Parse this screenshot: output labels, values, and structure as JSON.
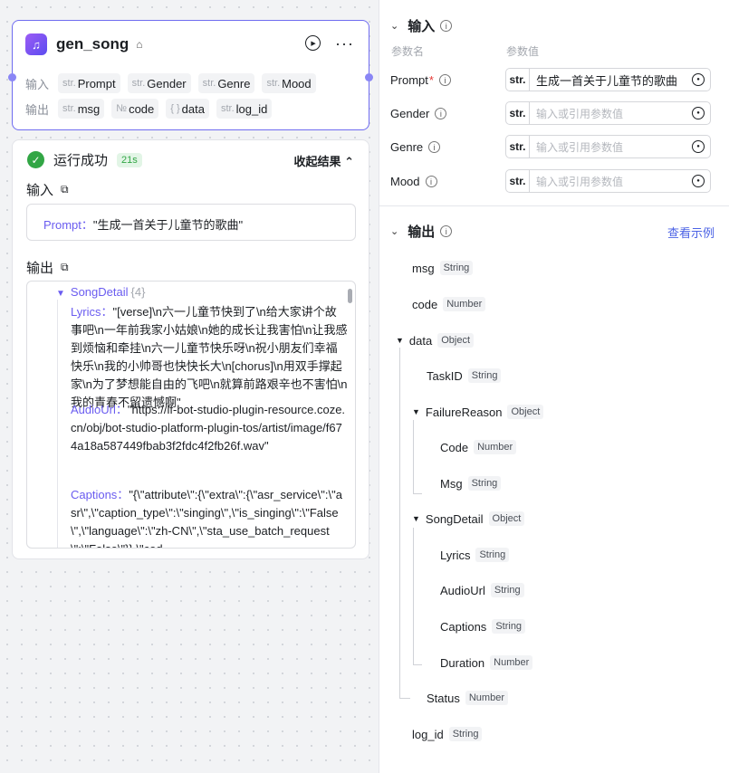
{
  "node": {
    "title": "gen_song",
    "input_label": "输入",
    "output_label": "输出",
    "inputs": [
      {
        "type": "str.",
        "name": "Prompt"
      },
      {
        "type": "str.",
        "name": "Gender"
      },
      {
        "type": "str.",
        "name": "Genre"
      },
      {
        "type": "str.",
        "name": "Mood"
      }
    ],
    "outputs": [
      {
        "type": "str.",
        "name": "msg"
      },
      {
        "type": "№",
        "name": "code"
      },
      {
        "type": "{ }",
        "name": "data"
      },
      {
        "type": "str.",
        "name": "log_id"
      }
    ]
  },
  "result": {
    "status": "运行成功",
    "time": "21s",
    "collapse_label": "收起结果 ⌃",
    "input_title": "输入",
    "input_key": "Prompt：",
    "input_value": "\"生成一首关于儿童节的歌曲\"",
    "output_title": "输出",
    "song_detail_key": "SongDetail",
    "song_detail_count": "{4}",
    "lyrics_key": "Lyrics：",
    "lyrics_value": "\"[verse]\\n六一儿童节快到了\\n给大家讲个故事吧\\n一年前我家小姑娘\\n她的成长让我害怕\\n让我感到烦恼和牵挂\\n六一儿童节快乐呀\\n祝小朋友们幸福快乐\\n我的小帅哥也快快长大\\n[chorus]\\n用双手撑起家\\n为了梦想能自由的飞吧\\n就算前路艰辛也不害怕\\n我的青春不留遗憾啊\"",
    "audio_key": "AudioUrl：",
    "audio_value": "\"https://lf-bot-studio-plugin-resource.coze.cn/obj/bot-studio-platform-plugin-tos/artist/image/f674a18a587449fbab3f2fdc4f2fb26f.wav\"",
    "captions_key": "Captions：",
    "captions_value": "\"{\\\"attribute\\\":{\\\"extra\\\":{\\\"asr_service\\\":\\\"asr\\\",\\\"caption_type\\\":\\\"singing\\\",\\\"is_singing\\\":\\\"False\\\",\\\"language\\\":\\\"zh-CN\\\",\\\"sta_use_batch_request\\\":\\\"False\\\"}},\\\"cod"
  },
  "panel": {
    "input_title": "输入",
    "col_name": "参数名",
    "col_value": "参数值",
    "params": [
      {
        "name": "Prompt",
        "required": "*",
        "type": "str.",
        "value": "生成一首关于儿童节的歌曲"
      },
      {
        "name": "Gender",
        "required": "",
        "type": "str.",
        "placeholder": "输入或引用参数值"
      },
      {
        "name": "Genre",
        "required": "",
        "type": "str.",
        "placeholder": "输入或引用参数值"
      },
      {
        "name": "Mood",
        "required": "",
        "type": "str.",
        "placeholder": "输入或引用参数值"
      }
    ],
    "output_title": "输出",
    "example_link": "查看示例",
    "fields": [
      {
        "name": "msg",
        "type": "String"
      },
      {
        "name": "code",
        "type": "Number"
      },
      {
        "name": "data",
        "type": "Object"
      },
      {
        "name": "TaskID",
        "type": "String"
      },
      {
        "name": "FailureReason",
        "type": "Object"
      },
      {
        "name": "Code",
        "type": "Number"
      },
      {
        "name": "Msg",
        "type": "String"
      },
      {
        "name": "SongDetail",
        "type": "Object"
      },
      {
        "name": "Lyrics",
        "type": "String"
      },
      {
        "name": "AudioUrl",
        "type": "String"
      },
      {
        "name": "Captions",
        "type": "String"
      },
      {
        "name": "Duration",
        "type": "Number"
      },
      {
        "name": "Status",
        "type": "Number"
      },
      {
        "name": "log_id",
        "type": "String"
      }
    ]
  }
}
